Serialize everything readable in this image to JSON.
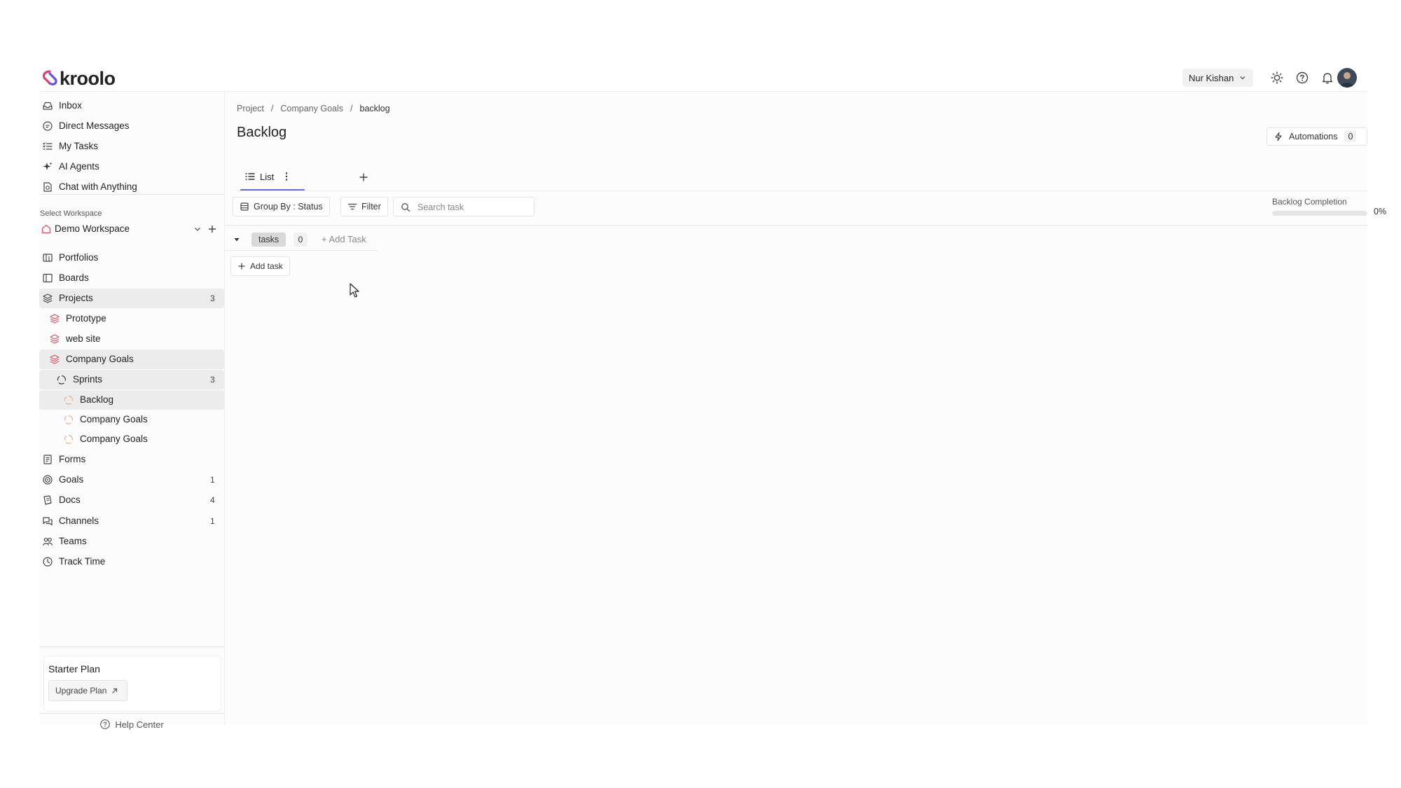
{
  "app": {
    "name": "kroolo"
  },
  "header": {
    "user_name": "Nur Kishan"
  },
  "sidebar": {
    "top_items": [
      {
        "label": "Inbox",
        "icon": "inbox-icon"
      },
      {
        "label": "Direct Messages",
        "icon": "message-icon"
      },
      {
        "label": "My Tasks",
        "icon": "tasks-icon"
      },
      {
        "label": "AI Agents",
        "icon": "sparkle-icon"
      },
      {
        "label": "Chat with Anything",
        "icon": "chat-file-icon"
      }
    ],
    "workspace_label": "Select Workspace",
    "workspace_name": "Demo Workspace",
    "items": [
      {
        "label": "Portfolios",
        "icon": "portfolio-icon",
        "count": ""
      },
      {
        "label": "Boards",
        "icon": "board-icon",
        "count": ""
      },
      {
        "label": "Projects",
        "icon": "layers-icon",
        "count": "3"
      },
      {
        "label": "Prototype",
        "icon": "layers-icon",
        "count": ""
      },
      {
        "label": "web site",
        "icon": "layers-icon",
        "count": ""
      },
      {
        "label": "Company Goals",
        "icon": "layers-icon",
        "count": ""
      },
      {
        "label": "Sprints",
        "icon": "sprint-icon",
        "count": "3"
      },
      {
        "label": "Backlog",
        "icon": "sprint-icon",
        "count": ""
      },
      {
        "label": "Company Goals",
        "icon": "sprint-icon",
        "count": ""
      },
      {
        "label": "Company Goals",
        "icon": "sprint-icon",
        "count": ""
      },
      {
        "label": "Forms",
        "icon": "form-icon",
        "count": ""
      },
      {
        "label": "Goals",
        "icon": "target-icon",
        "count": "1"
      },
      {
        "label": "Docs",
        "icon": "doc-icon",
        "count": "4"
      },
      {
        "label": "Channels",
        "icon": "channel-icon",
        "count": "1"
      },
      {
        "label": "Teams",
        "icon": "team-icon",
        "count": ""
      },
      {
        "label": "Track Time",
        "icon": "clock-icon",
        "count": ""
      }
    ],
    "plan_title": "Starter Plan",
    "upgrade_label": "Upgrade Plan",
    "help_label": "Help Center"
  },
  "main": {
    "breadcrumb": [
      "Project",
      "Company Goals",
      "backlog"
    ],
    "title": "Backlog",
    "automations_label": "Automations",
    "automations_count": "0",
    "tab_label": "List",
    "group_by_label": "Group By : Status",
    "filter_label": "Filter",
    "search_placeholder": "Search task",
    "completion_label": "Backlog Completion",
    "completion_value": "0%",
    "completion_fraction": 0,
    "group_name": "tasks",
    "group_count": "0",
    "group_add_label": "+ Add Task",
    "add_task_label": "Add task"
  },
  "colors": {
    "accent": "#5a6fd8",
    "logo_pink": "#e0407a",
    "logo_purple": "#6a4fd8",
    "project_icon": "#d9586a"
  }
}
